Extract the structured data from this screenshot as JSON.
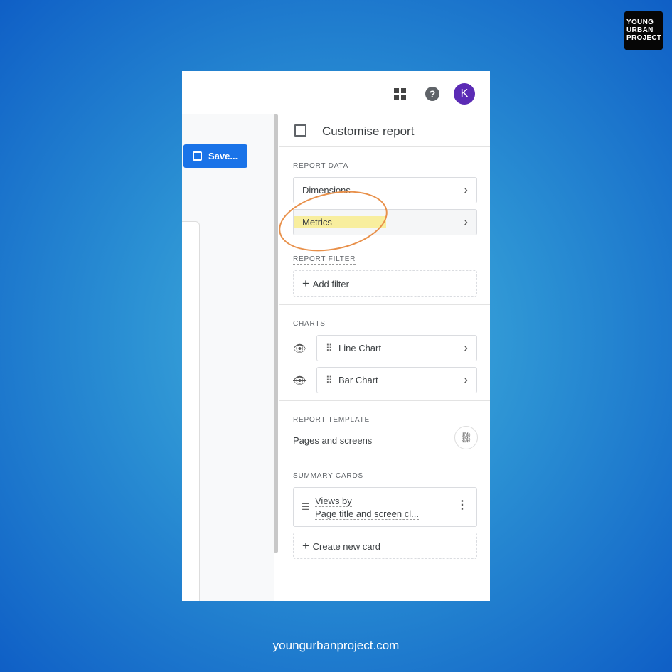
{
  "brand": {
    "logo_lines": [
      "YOUNG",
      "URBAN",
      "PROJECT"
    ],
    "footer": "youngurbanproject.com"
  },
  "topbar": {
    "apps_icon": "apps-grid-icon",
    "help": "?",
    "avatar": "K",
    "avatar_color": "#5b2bb5"
  },
  "left": {
    "save_label": "Save..."
  },
  "panel": {
    "title": "Customise report",
    "report_data": {
      "label": "REPORT DATA",
      "items": [
        {
          "label": "Dimensions"
        },
        {
          "label": "Metrics",
          "highlighted": true
        }
      ]
    },
    "report_filter": {
      "label": "REPORT FILTER",
      "add": "Add filter"
    },
    "charts": {
      "label": "CHARTS",
      "items": [
        {
          "label": "Line Chart",
          "visible": true
        },
        {
          "label": "Bar Chart",
          "visible": false
        }
      ]
    },
    "template": {
      "label": "REPORT TEMPLATE",
      "name": "Pages and screens"
    },
    "summary": {
      "label": "SUMMARY CARDS",
      "card_line1": "Views by",
      "card_line2": "Page title and screen cl...",
      "create": "Create new card"
    }
  },
  "colors": {
    "accent": "#1a73e8",
    "annotation": "#e8904a",
    "highlight": "#faeb78"
  }
}
